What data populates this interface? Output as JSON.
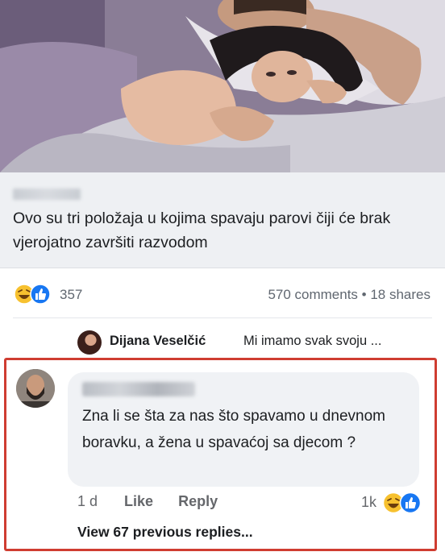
{
  "post": {
    "link_headline": "Ovo su tri položaja u kojima spavaju parovi čiji će brak vjerojatno završiti razvodom",
    "reaction_count": "357",
    "comments_shares": "570 comments • 18 shares",
    "reaction_icons": [
      "haha-icon",
      "like-icon"
    ]
  },
  "comment_preview": {
    "author": "Dijana Veselčić",
    "text": "Mi imamo svak svoju ..."
  },
  "comment": {
    "text": "Zna li se šta za nas što spavamo u dnevnom boravku, a žena u spavaćoj sa djecom ?",
    "time": "1 d",
    "like_label": "Like",
    "reply_label": "Reply",
    "reaction_count": "1k",
    "reaction_icons": [
      "haha-icon",
      "like-icon"
    ],
    "view_replies": "View 67 previous replies..."
  },
  "colors": {
    "highlight_border": "#cf3d31",
    "haha_yellow": "#f7c12f",
    "like_blue": "#1877f2"
  }
}
